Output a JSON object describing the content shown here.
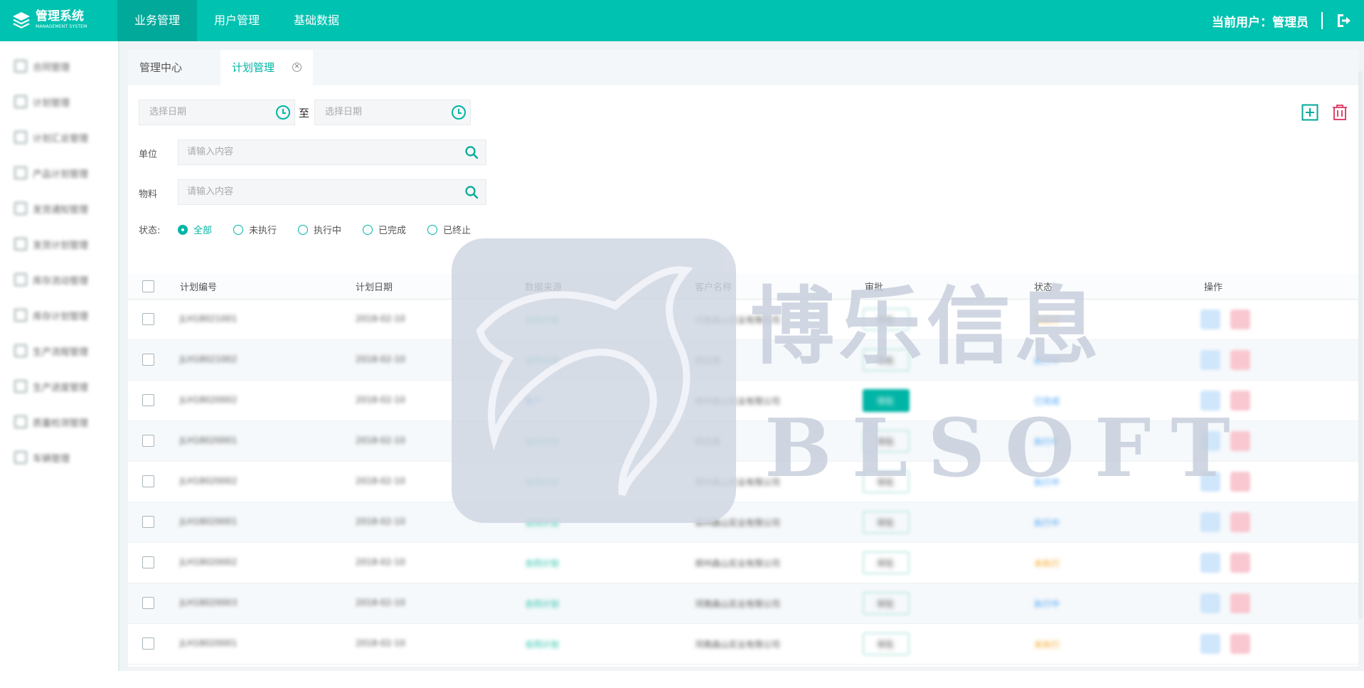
{
  "app": {
    "title": "管理系统",
    "subtitle": "MANAGEMENT SYSTEM",
    "logo_icon": "layers-icon"
  },
  "topnav": [
    {
      "label": "业务管理",
      "active": true
    },
    {
      "label": "用户管理",
      "active": false
    },
    {
      "label": "基础数据",
      "active": false
    }
  ],
  "user": {
    "label": "当前用户：管理员",
    "logout_icon": "logout-icon"
  },
  "sidebar": {
    "items": [
      {
        "label": "合同管理"
      },
      {
        "label": "计划管理"
      },
      {
        "label": "计划汇总管理"
      },
      {
        "label": "产品计划管理"
      },
      {
        "label": "发货通知管理"
      },
      {
        "label": "发货计划管理"
      },
      {
        "label": "库存流动管理"
      },
      {
        "label": "库存计划管理"
      },
      {
        "label": "生产流程管理"
      },
      {
        "label": "生产进度管理"
      },
      {
        "label": "质量检测管理"
      },
      {
        "label": "车辆管理"
      }
    ]
  },
  "tabs": [
    {
      "label": "管理中心"
    },
    {
      "label": "计划管理",
      "active": true,
      "closable": true
    }
  ],
  "filters": {
    "date_start_placeholder": "选择日期",
    "date_to": "至",
    "date_end_placeholder": "选择日期",
    "unit_label": "单位",
    "unit_placeholder": "请输入内容",
    "material_label": "物料",
    "material_placeholder": "请输入内容",
    "status_label": "状态:",
    "status_options": [
      "全部",
      "未执行",
      "执行中",
      "已完成",
      "已终止"
    ],
    "status_selected": "全部"
  },
  "actions": {
    "add_icon": "plus-square-icon",
    "delete_icon": "trash-icon"
  },
  "watermark": {
    "text": "博乐信息",
    "latin": "BLSOFT"
  },
  "table": {
    "headers": [
      "计划编号",
      "计划日期",
      "数据来源",
      "客户名称",
      "审批",
      "状态",
      "操作"
    ],
    "rows": [
      {
        "id": "JLH18021001",
        "date": "2018-02-10",
        "source": "合同计划",
        "customer": "河南森山实业有限公司",
        "approve": "审批",
        "status": "未执行"
      },
      {
        "id": "JLH18021002",
        "date": "2018-02-10",
        "source": "合同计划",
        "customer": "供应商",
        "approve": "审批",
        "status": "执行中"
      },
      {
        "id": "JLH18020002",
        "date": "2018-02-10",
        "source": "客户",
        "customer": "郑州森山实业有限公司",
        "approve": "审批",
        "status": "已完成"
      },
      {
        "id": "JLH18020001",
        "date": "2018-02-10",
        "source": "合同计划",
        "customer": "供应商",
        "approve": "审批",
        "status": "执行中"
      },
      {
        "id": "JLH18020002",
        "date": "2018-02-10",
        "source": "合同计划",
        "customer": "郑州森山实业有限公司",
        "approve": "审批",
        "status": "执行中"
      },
      {
        "id": "JLH18020001",
        "date": "2018-02-10",
        "source": "合同计划",
        "customer": "郑州森山实业有限公司",
        "approve": "审批",
        "status": "执行中"
      },
      {
        "id": "JLH18020002",
        "date": "2018-02-10",
        "source": "合同计划",
        "customer": "郑州森山实业有限公司",
        "approve": "审批",
        "status": "未执行"
      },
      {
        "id": "JLH18020003",
        "date": "2018-02-10",
        "source": "合同计划",
        "customer": "河南森山实业有限公司",
        "approve": "审批",
        "status": "执行中"
      },
      {
        "id": "JLH18020001",
        "date": "2018-02-10",
        "source": "合同计划",
        "customer": "河南森山实业有限公司",
        "approve": "审批",
        "status": "未执行"
      }
    ]
  },
  "colors": {
    "brand": "#00c2b0",
    "accent": "#00b5a5",
    "status_orange": "#f5a623",
    "status_blue": "#4aa3f5",
    "delete": "#e0456a"
  }
}
